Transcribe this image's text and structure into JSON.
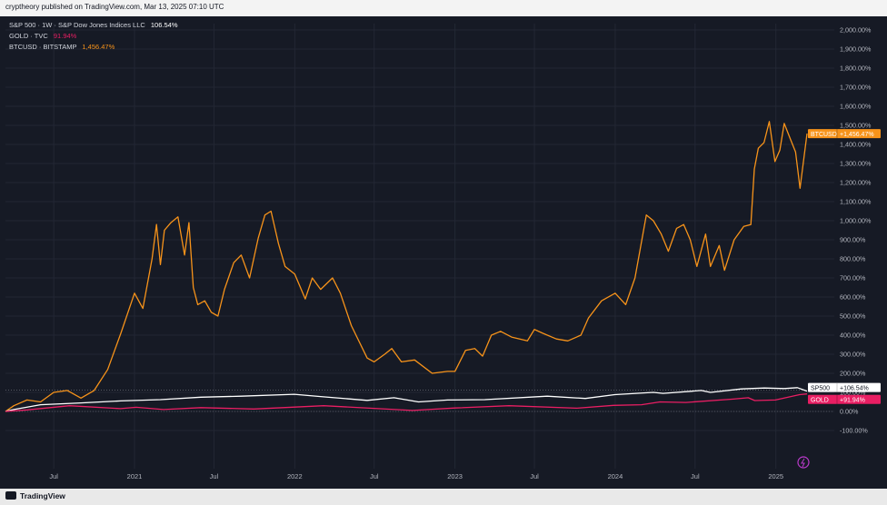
{
  "header": {
    "text": "cryptheory published on TradingView.com, Mar 13, 2025 07:10 UTC"
  },
  "legend": [
    {
      "label": "S&P 500 · 1W · S&P Dow Jones Indices LLC",
      "value": "106.54%",
      "color": "#ffffff"
    },
    {
      "label": "GOLD · TVC",
      "value": "91.94%",
      "color": "#e91e63"
    },
    {
      "label": "BTCUSD · BITSTAMP",
      "value": "1,456.47%",
      "color": "#f7931a"
    }
  ],
  "footer": {
    "brand": "TradingView"
  },
  "chart_data": {
    "type": "line",
    "ylim": [
      -100,
      2050
    ],
    "y_ticks": [
      -100,
      0,
      100,
      200,
      300,
      400,
      500,
      600,
      700,
      800,
      900,
      1000,
      1100,
      1200,
      1300,
      1400,
      1500,
      1600,
      1700,
      1800,
      1900,
      2000
    ],
    "y_tick_labels": [
      "-100.00%",
      "0.00%",
      "100.00%",
      "200.00%",
      "300.00%",
      "400.00%",
      "500.00%",
      "600.00%",
      "700.00%",
      "800.00%",
      "900.00%",
      "1,000.00%",
      "1,100.00%",
      "1,200.00%",
      "1,300.00%",
      "1,400.00%",
      "1,500.00%",
      "1,600.00%",
      "1,700.00%",
      "1,800.00%",
      "1,900.00%",
      "2,000.00%"
    ],
    "x_range": [
      "2020-03-13",
      "2025-03-13"
    ],
    "x_ticks": [
      {
        "date": "2020-07-01",
        "label": "Jul"
      },
      {
        "date": "2021-01-01",
        "label": "2021"
      },
      {
        "date": "2021-07-01",
        "label": "Jul"
      },
      {
        "date": "2022-01-01",
        "label": "2022"
      },
      {
        "date": "2022-07-01",
        "label": "Jul"
      },
      {
        "date": "2023-01-01",
        "label": "2023"
      },
      {
        "date": "2023-07-01",
        "label": "Jul"
      },
      {
        "date": "2024-01-01",
        "label": "2024"
      },
      {
        "date": "2024-07-01",
        "label": "Jul"
      },
      {
        "date": "2025-01-01",
        "label": "2025"
      }
    ],
    "grid": true,
    "legend_position": "top-left",
    "series": [
      {
        "name": "BTCUSD",
        "color": "#f7931a",
        "last_label": "+1,456.47%",
        "points": [
          [
            "2020-03-13",
            0
          ],
          [
            "2020-04-01",
            30
          ],
          [
            "2020-05-01",
            60
          ],
          [
            "2020-06-01",
            50
          ],
          [
            "2020-07-01",
            100
          ],
          [
            "2020-08-01",
            110
          ],
          [
            "2020-09-01",
            70
          ],
          [
            "2020-10-01",
            110
          ],
          [
            "2020-11-01",
            220
          ],
          [
            "2020-12-01",
            410
          ],
          [
            "2021-01-01",
            620
          ],
          [
            "2021-01-20",
            540
          ],
          [
            "2021-02-10",
            800
          ],
          [
            "2021-02-20",
            980
          ],
          [
            "2021-03-01",
            770
          ],
          [
            "2021-03-10",
            950
          ],
          [
            "2021-03-25",
            990
          ],
          [
            "2021-04-10",
            1020
          ],
          [
            "2021-04-25",
            820
          ],
          [
            "2021-05-05",
            990
          ],
          [
            "2021-05-15",
            650
          ],
          [
            "2021-05-25",
            560
          ],
          [
            "2021-06-10",
            580
          ],
          [
            "2021-06-25",
            520
          ],
          [
            "2021-07-10",
            500
          ],
          [
            "2021-07-25",
            640
          ],
          [
            "2021-08-15",
            780
          ],
          [
            "2021-09-01",
            820
          ],
          [
            "2021-09-20",
            700
          ],
          [
            "2021-10-10",
            910
          ],
          [
            "2021-10-25",
            1030
          ],
          [
            "2021-11-08",
            1050
          ],
          [
            "2021-11-25",
            880
          ],
          [
            "2021-12-10",
            760
          ],
          [
            "2022-01-01",
            720
          ],
          [
            "2022-01-25",
            590
          ],
          [
            "2022-02-10",
            700
          ],
          [
            "2022-03-01",
            640
          ],
          [
            "2022-03-28",
            700
          ],
          [
            "2022-04-15",
            620
          ],
          [
            "2022-05-10",
            450
          ],
          [
            "2022-06-15",
            280
          ],
          [
            "2022-07-01",
            260
          ],
          [
            "2022-07-25",
            300
          ],
          [
            "2022-08-10",
            330
          ],
          [
            "2022-09-01",
            260
          ],
          [
            "2022-10-01",
            270
          ],
          [
            "2022-11-10",
            200
          ],
          [
            "2022-12-15",
            210
          ],
          [
            "2023-01-01",
            210
          ],
          [
            "2023-01-25",
            320
          ],
          [
            "2023-02-15",
            330
          ],
          [
            "2023-03-05",
            290
          ],
          [
            "2023-03-25",
            400
          ],
          [
            "2023-04-15",
            420
          ],
          [
            "2023-05-10",
            390
          ],
          [
            "2023-06-15",
            370
          ],
          [
            "2023-07-01",
            430
          ],
          [
            "2023-07-20",
            410
          ],
          [
            "2023-08-20",
            380
          ],
          [
            "2023-09-15",
            370
          ],
          [
            "2023-10-15",
            400
          ],
          [
            "2023-11-01",
            490
          ],
          [
            "2023-12-01",
            580
          ],
          [
            "2024-01-01",
            620
          ],
          [
            "2024-01-25",
            560
          ],
          [
            "2024-02-15",
            700
          ],
          [
            "2024-03-12",
            1030
          ],
          [
            "2024-03-28",
            1000
          ],
          [
            "2024-04-15",
            930
          ],
          [
            "2024-05-01",
            840
          ],
          [
            "2024-05-20",
            960
          ],
          [
            "2024-06-05",
            980
          ],
          [
            "2024-06-20",
            900
          ],
          [
            "2024-07-05",
            760
          ],
          [
            "2024-07-25",
            930
          ],
          [
            "2024-08-05",
            760
          ],
          [
            "2024-08-25",
            870
          ],
          [
            "2024-09-06",
            740
          ],
          [
            "2024-09-28",
            900
          ],
          [
            "2024-10-20",
            970
          ],
          [
            "2024-11-05",
            980
          ],
          [
            "2024-11-13",
            1270
          ],
          [
            "2024-11-22",
            1380
          ],
          [
            "2024-12-05",
            1410
          ],
          [
            "2024-12-17",
            1520
          ],
          [
            "2024-12-30",
            1310
          ],
          [
            "2025-01-10",
            1370
          ],
          [
            "2025-01-20",
            1510
          ],
          [
            "2025-02-01",
            1440
          ],
          [
            "2025-02-15",
            1360
          ],
          [
            "2025-02-25",
            1170
          ],
          [
            "2025-03-13",
            1456.47
          ]
        ]
      },
      {
        "name": "SP500",
        "color": "#ffffff",
        "last_label": "+106.54%",
        "points": [
          [
            "2020-03-13",
            0
          ],
          [
            "2020-04-01",
            10
          ],
          [
            "2020-06-01",
            35
          ],
          [
            "2020-09-01",
            45
          ],
          [
            "2020-12-01",
            55
          ],
          [
            "2021-03-01",
            62
          ],
          [
            "2021-06-01",
            75
          ],
          [
            "2021-09-01",
            80
          ],
          [
            "2021-12-31",
            90
          ],
          [
            "2022-03-01",
            78
          ],
          [
            "2022-06-15",
            58
          ],
          [
            "2022-08-15",
            72
          ],
          [
            "2022-10-10",
            50
          ],
          [
            "2022-12-15",
            60
          ],
          [
            "2023-03-10",
            62
          ],
          [
            "2023-07-30",
            80
          ],
          [
            "2023-10-25",
            68
          ],
          [
            "2023-12-31",
            88
          ],
          [
            "2024-03-28",
            100
          ],
          [
            "2024-04-19",
            95
          ],
          [
            "2024-07-15",
            110
          ],
          [
            "2024-08-05",
            100
          ],
          [
            "2024-10-15",
            118
          ],
          [
            "2024-12-06",
            123
          ],
          [
            "2025-01-20",
            120
          ],
          [
            "2025-02-19",
            125
          ],
          [
            "2025-03-13",
            106.54
          ]
        ]
      },
      {
        "name": "GOLD",
        "color": "#e91e63",
        "last_label": "+91.94%",
        "points": [
          [
            "2020-03-13",
            0
          ],
          [
            "2020-05-01",
            8
          ],
          [
            "2020-08-06",
            30
          ],
          [
            "2020-11-30",
            15
          ],
          [
            "2021-01-05",
            22
          ],
          [
            "2021-03-08",
            10
          ],
          [
            "2021-06-01",
            20
          ],
          [
            "2021-09-30",
            13
          ],
          [
            "2022-03-08",
            30
          ],
          [
            "2022-09-26",
            5
          ],
          [
            "2023-01-01",
            18
          ],
          [
            "2023-05-04",
            30
          ],
          [
            "2023-10-05",
            17
          ],
          [
            "2023-12-28",
            32
          ],
          [
            "2024-03-01",
            35
          ],
          [
            "2024-04-12",
            50
          ],
          [
            "2024-06-10",
            47
          ],
          [
            "2024-09-26",
            65
          ],
          [
            "2024-10-30",
            72
          ],
          [
            "2024-11-14",
            57
          ],
          [
            "2024-12-31",
            60
          ],
          [
            "2025-02-24",
            88
          ],
          [
            "2025-03-13",
            91.94
          ]
        ]
      }
    ]
  }
}
